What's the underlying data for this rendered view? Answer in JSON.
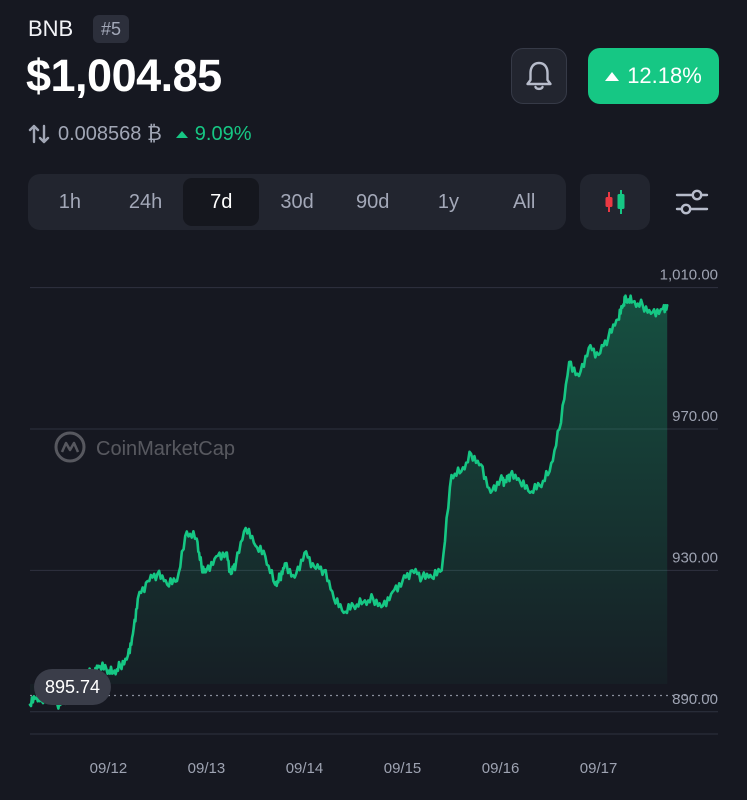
{
  "header": {
    "symbol": "BNB",
    "rank": "#5",
    "price": "$1,004.85",
    "change_percent": "12.18%",
    "colors": {
      "up": "#16c784",
      "down": "#ea3943",
      "background": "#161821"
    }
  },
  "btc_price": {
    "icon": "swap-vertical-icon",
    "value": "0.008568 ₿",
    "change": "9.09%"
  },
  "toolbar": {
    "tabs": [
      "1h",
      "24h",
      "7d",
      "30d",
      "90d",
      "1y",
      "All"
    ],
    "active_tab": "7d",
    "bell_icon": "bell-icon",
    "candle_icon": "candlestick-icon",
    "filter_icon": "sliders-icon"
  },
  "watermark": "CoinMarketCap",
  "chart_data": {
    "type": "line",
    "y_ticks": [
      "1,010.00",
      "970.00",
      "930.00",
      "890.00"
    ],
    "y_tick_values": [
      1010,
      970,
      930,
      890
    ],
    "x_ticks": [
      "09/12",
      "09/13",
      "09/14",
      "09/15",
      "09/16",
      "09/17"
    ],
    "x_tick_positions": [
      0.8,
      1.8,
      2.8,
      3.8,
      4.8,
      5.8
    ],
    "ylim": [
      884,
      1015
    ],
    "xlim": [
      0,
      6.6
    ],
    "start_price_label": "895.74",
    "start_price": 895.74,
    "grid": true,
    "x": [
      0,
      0.06,
      0.12,
      0.2,
      0.28,
      0.34,
      0.4,
      0.45,
      0.52,
      0.6,
      0.65,
      0.7,
      0.78,
      0.85,
      0.92,
      1.0,
      1.05,
      1.1,
      1.2,
      1.3,
      1.4,
      1.5,
      1.6,
      1.7,
      1.75,
      1.8,
      1.9,
      2.0,
      2.05,
      2.1,
      2.2,
      2.3,
      2.4,
      2.5,
      2.55,
      2.6,
      2.7,
      2.8,
      2.9,
      3.0,
      3.1,
      3.2,
      3.3,
      3.4,
      3.5,
      3.6,
      3.7,
      3.8,
      3.9,
      4.0,
      4.1,
      4.2,
      4.3,
      4.4,
      4.5,
      4.6,
      4.7,
      4.8,
      4.85,
      4.9,
      5.0,
      5.1,
      5.2,
      5.3,
      5.4,
      5.5,
      5.6,
      5.7,
      5.8,
      5.9,
      6.0,
      6.05,
      6.08,
      6.15,
      6.25,
      6.35,
      6.45,
      6.5
    ],
    "y": [
      892,
      894,
      893,
      896,
      892,
      894,
      893,
      895,
      897,
      901,
      900,
      903,
      902,
      901,
      903,
      906,
      912,
      922,
      927,
      929,
      926,
      927,
      941,
      939,
      931,
      930,
      934,
      935,
      929,
      932,
      942,
      937,
      934,
      926,
      928,
      932,
      928,
      935,
      931,
      930,
      922,
      918,
      920,
      921,
      922,
      920,
      924,
      927,
      930,
      928,
      928,
      930,
      957,
      958,
      963,
      960,
      952,
      956,
      955,
      957,
      955,
      952,
      954,
      958,
      970,
      989,
      985,
      993,
      991,
      996,
      1001,
      1005,
      1007,
      1006,
      1005,
      1003,
      1004,
      1005
    ]
  }
}
